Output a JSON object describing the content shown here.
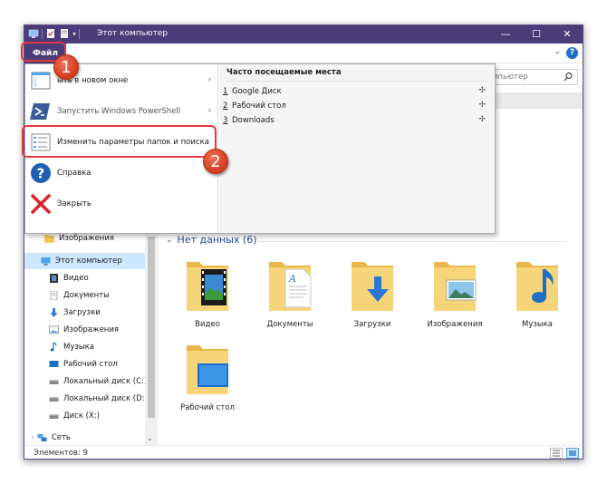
{
  "window": {
    "title": "Этот компьютер",
    "minimize": "—",
    "maximize": "☐",
    "close": "✕"
  },
  "ribbon": {
    "file_tab": "Файл",
    "help": "?",
    "chevron": "⌄"
  },
  "search": {
    "placeholder_visible": "мпьютер",
    "icon": "search-icon"
  },
  "file_menu": {
    "items": [
      {
        "label": "Открыть в новом окне",
        "visible_label": "ыть в новом окне",
        "icon": "new-window-icon",
        "has_arrow": true
      },
      {
        "label": "Запустить Windows PowerShell",
        "icon": "powershell-icon",
        "has_arrow": true
      },
      {
        "label": "Изменить параметры папок и поиска",
        "icon": "folder-options-icon",
        "has_arrow": false
      },
      {
        "label": "Справка",
        "icon": "help-icon",
        "has_arrow": true
      },
      {
        "label": "Закрыть",
        "icon": "close-icon",
        "has_arrow": false
      }
    ],
    "arrow": "›",
    "frequent": {
      "title": "Часто посещаемые места",
      "items": [
        {
          "num": "1",
          "label": "Google Диск"
        },
        {
          "num": "2",
          "label": "Рабочий стол"
        },
        {
          "num": "3",
          "label": "Downloads"
        }
      ],
      "pin": "📌"
    }
  },
  "nav": {
    "items": [
      {
        "label": "Изображения",
        "icon": "folder-icon"
      },
      {
        "label": "Этот компьютер",
        "icon": "computer-icon",
        "selected": true
      },
      {
        "label": "Видео",
        "icon": "video-icon"
      },
      {
        "label": "Документы",
        "icon": "documents-icon"
      },
      {
        "label": "Загрузки",
        "icon": "downloads-icon"
      },
      {
        "label": "Изображения",
        "icon": "pictures-icon"
      },
      {
        "label": "Музыка",
        "icon": "music-icon"
      },
      {
        "label": "Рабочий стол",
        "icon": "desktop-icon"
      },
      {
        "label": "Локальный диск (C:)",
        "icon": "drive-icon"
      },
      {
        "label": "Локальный диск (D:)",
        "icon": "drive-icon"
      },
      {
        "label": "Диск (X:)",
        "icon": "drive-icon"
      },
      {
        "label": "Сеть",
        "icon": "network-icon"
      }
    ],
    "scroll_down": "⌄"
  },
  "content": {
    "group_title": "Нет данных (6)",
    "group_chevron": "⌄",
    "folders": [
      {
        "label": "Видео",
        "icon": "video-folder-icon"
      },
      {
        "label": "Документы",
        "icon": "documents-folder-icon"
      },
      {
        "label": "Загрузки",
        "icon": "downloads-folder-icon"
      },
      {
        "label": "Изображения",
        "icon": "pictures-folder-icon"
      },
      {
        "label": "Музыка",
        "icon": "music-folder-icon"
      },
      {
        "label": "Рабочий стол",
        "icon": "desktop-folder-icon"
      }
    ]
  },
  "status": {
    "items_count": "Элементов: 9"
  },
  "annotations": {
    "step1": "1",
    "step2": "2",
    "color": "#e0383e"
  },
  "colors": {
    "titlebar": "#4a3d7a",
    "accent": "#1f6fc5",
    "selection": "#cce8ff"
  }
}
